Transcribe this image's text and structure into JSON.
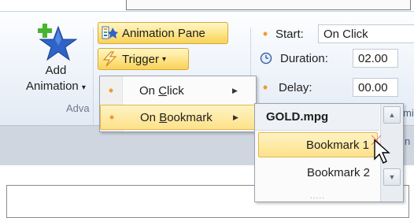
{
  "ribbon": {
    "add_animation": {
      "line1": "Add",
      "line2": "Animation",
      "caret": "▾",
      "icon": "star-plus-icon"
    },
    "advanced_group_label": "Adva",
    "animation_pane": {
      "label": "Animation Pane",
      "icon": "animation-pane-icon"
    },
    "trigger": {
      "label": "Trigger",
      "caret": "▾",
      "icon": "lightning-icon"
    },
    "timing": {
      "start": {
        "label": "Start:",
        "value": "On Click"
      },
      "duration": {
        "label": "Duration:",
        "value": "02.00"
      },
      "delay": {
        "label": "Delay:",
        "value": "00.00"
      },
      "partial_letters": [
        "mi",
        "n"
      ]
    }
  },
  "trigger_menu": {
    "items": [
      {
        "label": "On Click",
        "underline": "C"
      },
      {
        "label": "On Bookmark",
        "underline": "B"
      }
    ]
  },
  "bookmark_menu": {
    "header": "GOLD.mpg",
    "items": [
      "Bookmark 1",
      "Bookmark 2"
    ],
    "grip": "....."
  },
  "colors": {
    "accent": "#f29a2e",
    "highlight": "#fde28a",
    "border": "#e3b64e"
  }
}
